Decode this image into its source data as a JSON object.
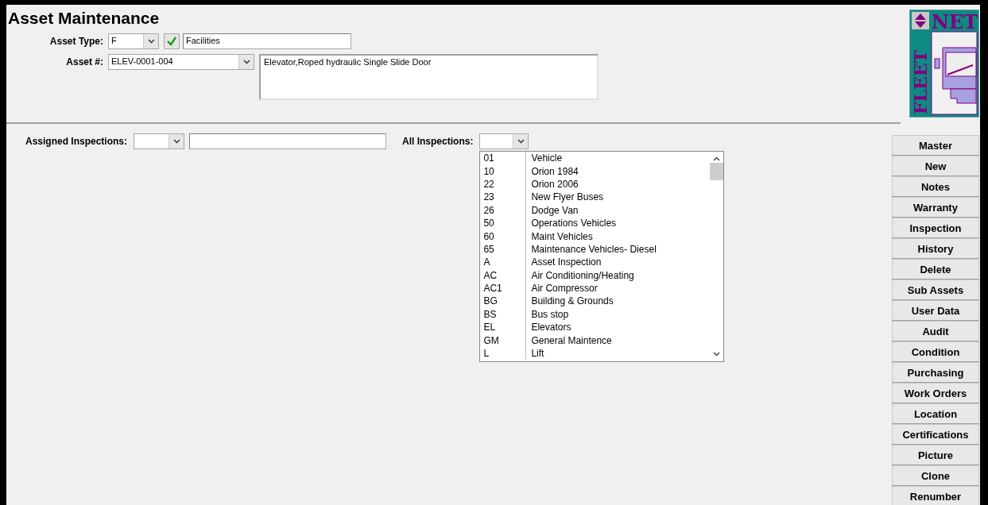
{
  "title": "Asset Maintenance",
  "asset_type": {
    "label": "Asset Type:",
    "code": "F",
    "valid": true,
    "name": "Facilities"
  },
  "asset_number": {
    "label": "Asset #:",
    "value": "ELEV-0001-004",
    "description": "Elevator,Roped hydraulic Single Slide Door"
  },
  "logo": {
    "top": "NET",
    "side": "FLEET"
  },
  "assigned_inspections": {
    "label": "Assigned Inspections:"
  },
  "all_inspections": {
    "label": "All Inspections:",
    "options": [
      {
        "code": "01",
        "name": "Vehicle"
      },
      {
        "code": "10",
        "name": "Orion 1984"
      },
      {
        "code": "22",
        "name": "Orion 2006"
      },
      {
        "code": "23",
        "name": "New Flyer Buses"
      },
      {
        "code": "26",
        "name": "Dodge Van"
      },
      {
        "code": "50",
        "name": "Operations Vehicles"
      },
      {
        "code": "60",
        "name": "Maint Vehicles"
      },
      {
        "code": "65",
        "name": "Maintenance Vehicles- Diesel"
      },
      {
        "code": "A",
        "name": "Asset Inspection"
      },
      {
        "code": "AC",
        "name": "Air Conditioning/Heating"
      },
      {
        "code": "AC1",
        "name": "Air Compressor"
      },
      {
        "code": "BG",
        "name": "Building & Grounds"
      },
      {
        "code": "BS",
        "name": "Bus stop"
      },
      {
        "code": "EL",
        "name": "Elevators"
      },
      {
        "code": "GM",
        "name": "General Maintence"
      },
      {
        "code": "L",
        "name": "Lift"
      }
    ]
  },
  "buttons": [
    "Master",
    "New",
    "Notes",
    "Warranty",
    "Inspection",
    "History",
    "Delete",
    "Sub Assets",
    "User Data",
    "Audit",
    "Condition",
    "Purchasing",
    "Work Orders",
    "Location",
    "Certifications",
    "Picture",
    "Clone",
    "Renumber"
  ]
}
